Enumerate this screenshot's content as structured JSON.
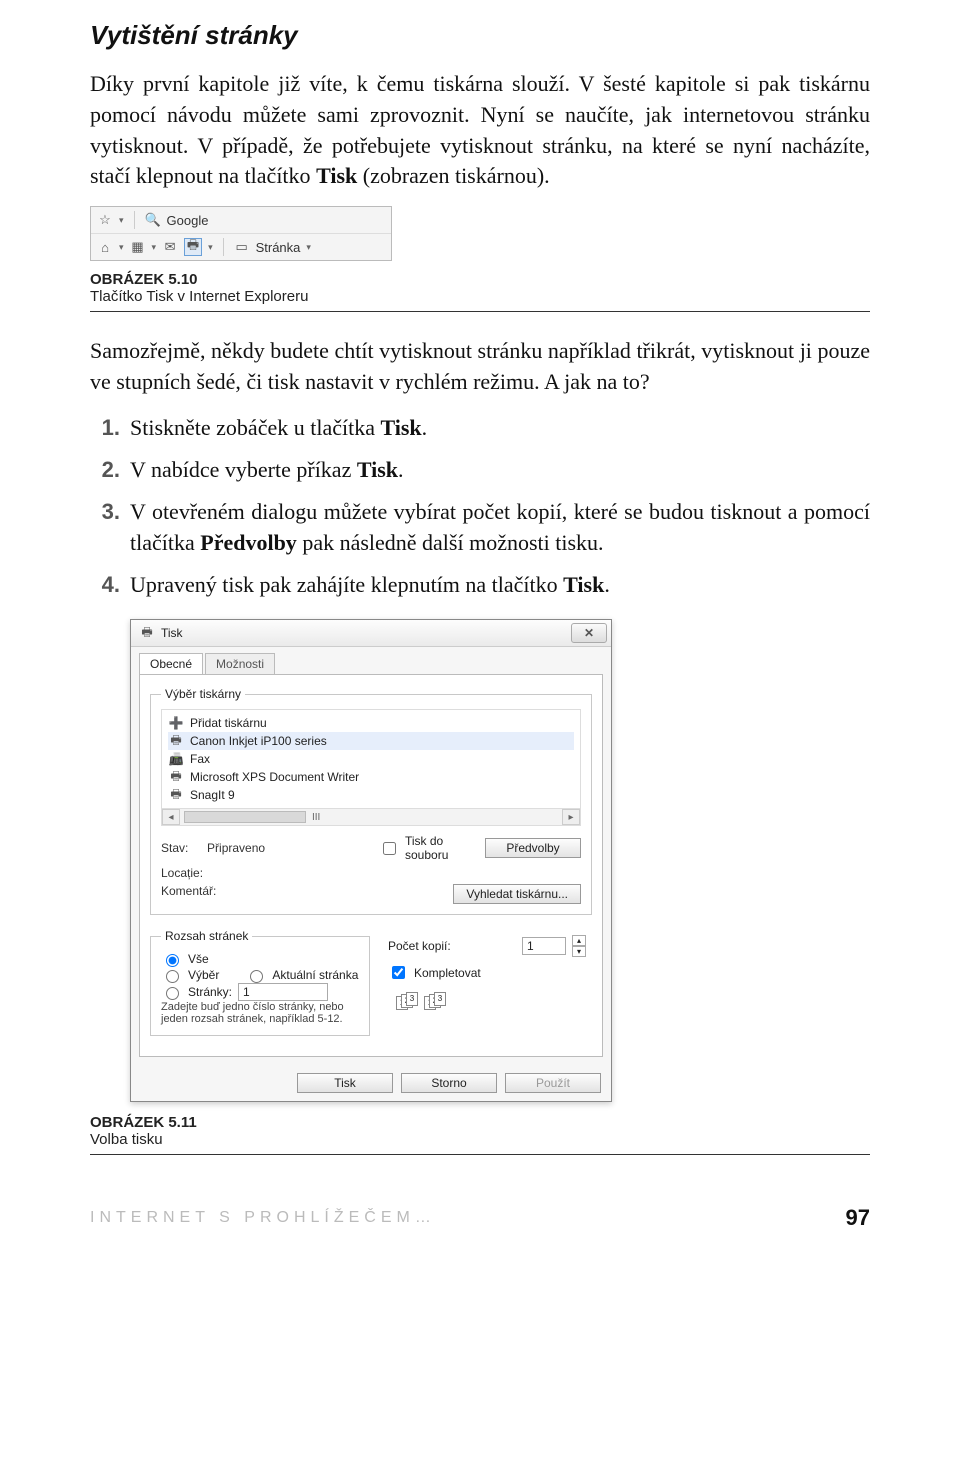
{
  "section_heading": "Vytištění stránky",
  "intro": "Díky první kapitole již víte, k čemu tiskárna slouží. V šesté kapitole si pak tiskárnu pomocí návodu můžete sami zprovoznit. Nyní se naučíte, jak internetovou stránku vytisknout. V případě, že potřebujete vytisknout stránku, na které se nyní nacházíte, stačí klepnout na tlačítko ",
  "intro_bold": "Tisk",
  "intro_tail": " (zobrazen tiskárnou).",
  "fig1": {
    "search_text": "Google",
    "page_label": "Stránka"
  },
  "caption1": {
    "label": "OBRÁZEK 5.10",
    "text": "Tlačítko Tisk v Internet Exploreru"
  },
  "mid_text": "Samozřejmě, někdy budete chtít vytisknout stránku například třikrát, vytisknout ji pouze ve stupních šedé, či tisk nastavit v rychlém režimu. A jak na to?",
  "steps": {
    "s1a": "Stiskněte zobáček u tlačítka ",
    "s1b": "Tisk",
    "s1c": ".",
    "s2a": "V nabídce vyberte příkaz ",
    "s2b": "Tisk",
    "s2c": ".",
    "s3a": "V otevřeném dialogu můžete vybírat počet kopií, které se budou tisknout a pomocí tlačítka ",
    "s3b": "Předvolby",
    "s3c": " pak následně další možnosti tisku.",
    "s4a": "Upravený tisk pak zahájíte klepnutím na tlačítko ",
    "s4b": "Tisk",
    "s4c": "."
  },
  "dialog": {
    "title": "Tisk",
    "tab_general": "Obecné",
    "tab_options": "Možnosti",
    "fs_printer": "Výběr tiskárny",
    "printers_left": [
      "Přidat tiskárnu",
      "Canon Inkjet iP100 series",
      "Fax"
    ],
    "printers_right": [
      "Microsoft XPS Document Writer",
      "SnagIt 9"
    ],
    "scroll_marker": "III",
    "status_label": "Stav:",
    "status_value": "Připraveno",
    "location_label": "Locație:",
    "comment_label": "Komentář:",
    "to_file": "Tisk do souboru",
    "prefs_btn": "Předvolby",
    "find_btn": "Vyhledat tiskárnu...",
    "fs_range": "Rozsah stránek",
    "opt_all": "Vše",
    "opt_selection": "Výběr",
    "opt_current": "Aktuální stránka",
    "opt_pages": "Stránky:",
    "pages_value": "1",
    "pages_hint": "Zadejte buď jedno číslo stránky, nebo jeden rozsah stránek, například 5-12.",
    "copies_label": "Počet kopií:",
    "copies_value": "1",
    "collate": "Kompletovat",
    "btn_print": "Tisk",
    "btn_cancel": "Storno",
    "btn_apply": "Použít"
  },
  "caption2": {
    "label": "OBRÁZEK 5.11",
    "text": "Volba tisku"
  },
  "footer": {
    "text": "INTERNET S PROHLÍŽEČEM…",
    "page": "97"
  }
}
